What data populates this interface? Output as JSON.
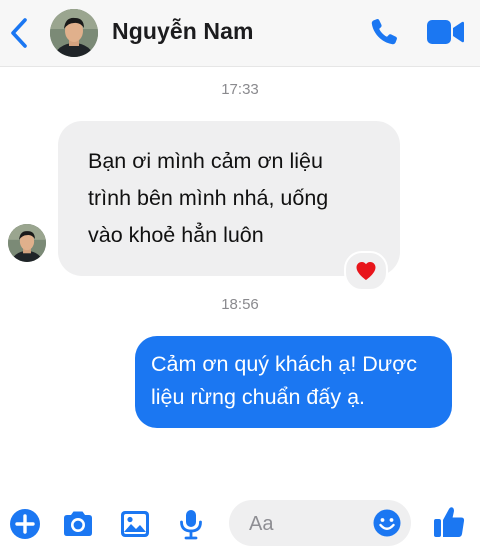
{
  "header": {
    "contact_name": "Nguyễn Nam",
    "back_icon": "chevron-left-icon",
    "call_icon": "phone-icon",
    "video_icon": "video-camera-icon",
    "accent_color": "#1b77f2"
  },
  "conversation": {
    "timestamps": [
      "17:33",
      "18:56"
    ],
    "incoming_message": {
      "lines": [
        "Bạn ơi mình cảm ơn liệu",
        "trình bên mình nhá, uống",
        "vào khoẻ hẳn luôn"
      ],
      "reaction": "❤️"
    },
    "outgoing_message": {
      "lines": [
        "Cảm ơn quý khách ạ! Dược",
        "liệu rừng chuẩn đấy ạ."
      ]
    }
  },
  "composer": {
    "placeholder": "Aa",
    "icons": [
      "plus-circle-icon",
      "camera-icon",
      "image-icon",
      "microphone-icon",
      "emoji-icon",
      "thumbs-up-icon"
    ]
  }
}
